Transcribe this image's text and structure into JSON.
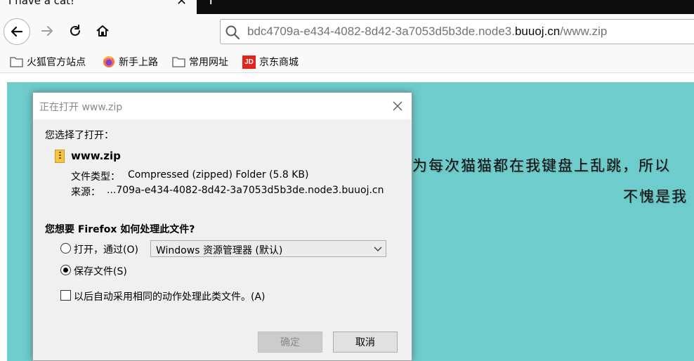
{
  "browser": {
    "tab": {
      "title": "I have a cat!",
      "close_glyph": "✕"
    },
    "new_tab_glyph": "+",
    "urlbar": {
      "prefix": "bdc4709a-e434-4082-8d42-3a7053d5b3de.node3.",
      "domain": "buuoj.cn",
      "path": "/www.zip"
    },
    "bookmarks": [
      {
        "label": "火狐官方站点",
        "icon": "folder-icon"
      },
      {
        "label": "新手上路",
        "icon": "firefox-icon"
      },
      {
        "label": "常用网址",
        "icon": "folder-icon"
      },
      {
        "label": "京东商城",
        "icon": "jd-icon",
        "icon_text": "JD"
      }
    ]
  },
  "page": {
    "line1": "为每次猫猫都在我键盘上乱跳，所以",
    "line2": "不愧是我",
    "background": "#6fcccc"
  },
  "dialog": {
    "title": "正在打开 www.zip",
    "chose_label": "您选择了打开：",
    "file_name": "www.zip",
    "file_type_label": "文件类型：",
    "file_type_value": "Compressed (zipped) Folder (5.8 KB)",
    "source_label": "来源：",
    "source_value": "...709a-e434-4082-8d42-3a7053d5b3de.node3.buuoj.cn",
    "question": "您想要 Firefox 如何处理此文件?",
    "open_with_label": "打开，通过(O)",
    "open_with_selected": "Windows 资源管理器 (默认)",
    "save_label": "保存文件(S)",
    "save_selected": true,
    "auto_label": "以后自动采用相同的动作处理此类文件。(A)",
    "ok_label": "确定",
    "cancel_label": "取消"
  }
}
